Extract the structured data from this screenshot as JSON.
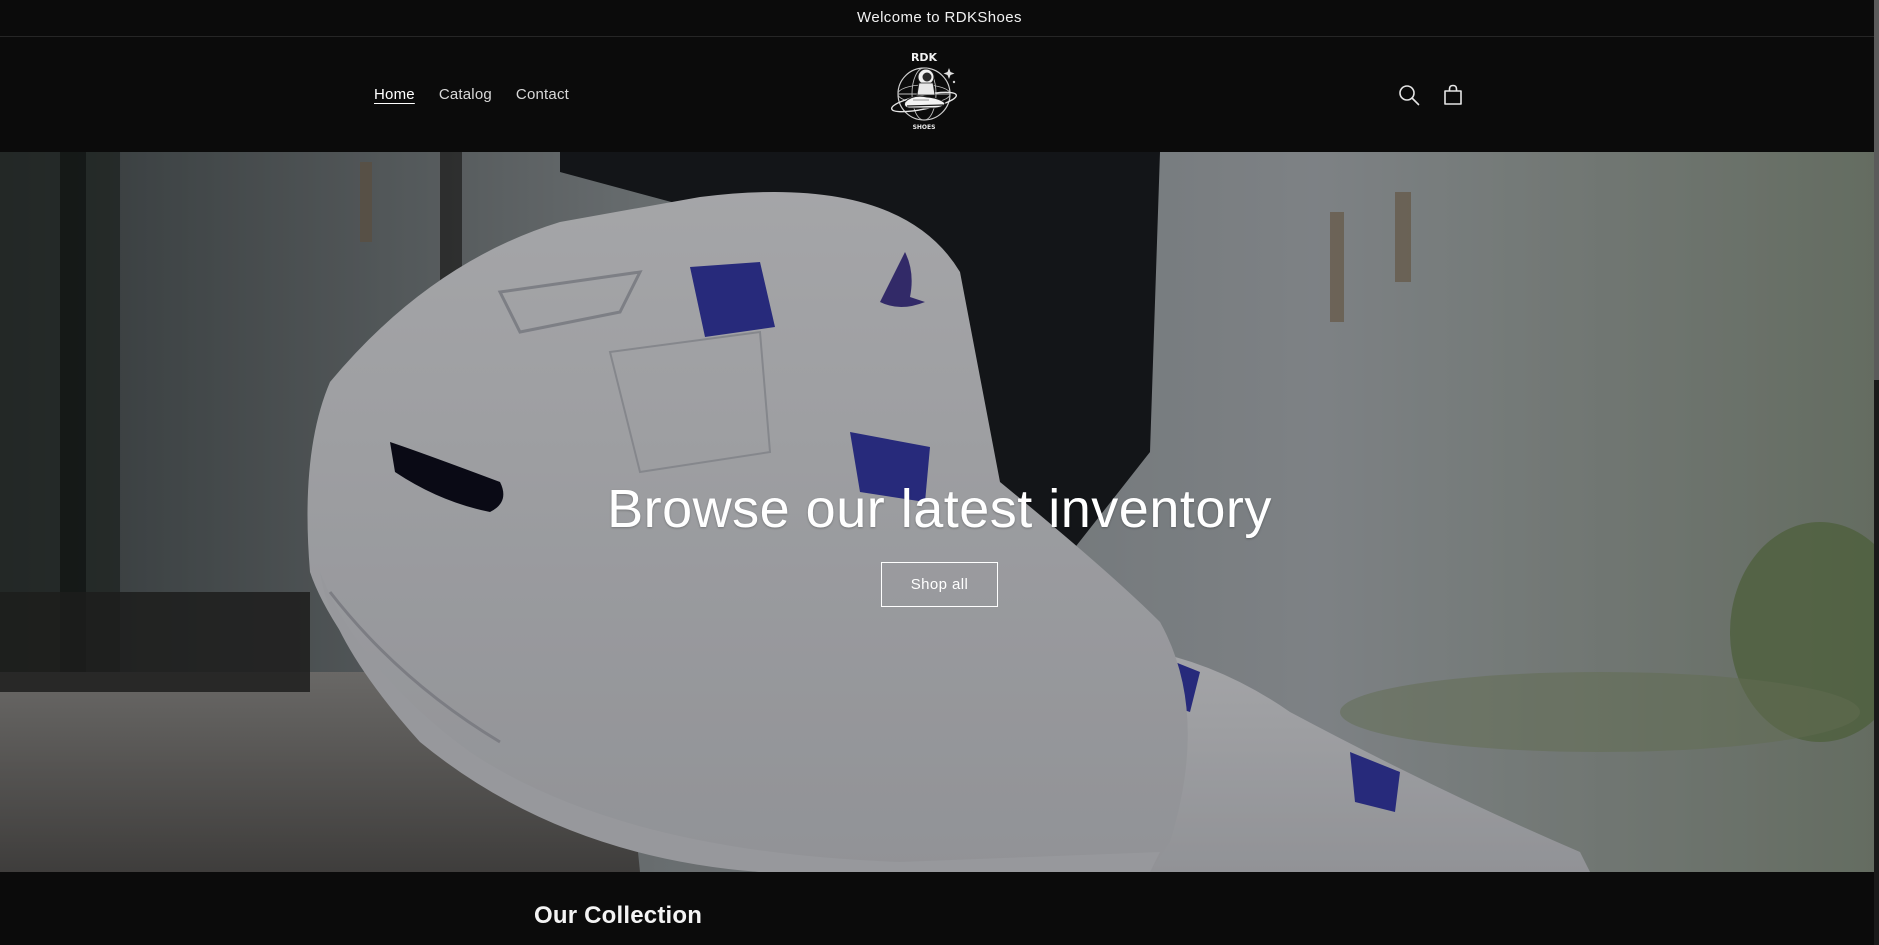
{
  "announcement": {
    "text": "Welcome to RDKShoes"
  },
  "header": {
    "nav": [
      {
        "label": "Home",
        "active": true
      },
      {
        "label": "Catalog",
        "active": false
      },
      {
        "label": "Contact",
        "active": false
      }
    ],
    "logo": {
      "top_text": "RDK",
      "bottom_text": "SHOES"
    },
    "icons": [
      "search-icon",
      "cart-icon"
    ]
  },
  "hero": {
    "title": "Browse our latest inventory",
    "button_label": "Shop all"
  },
  "collection": {
    "title": "Our Collection"
  },
  "colors": {
    "background": "#0b0b0b",
    "accent": "#3a3fb5",
    "text": "#ffffff"
  }
}
